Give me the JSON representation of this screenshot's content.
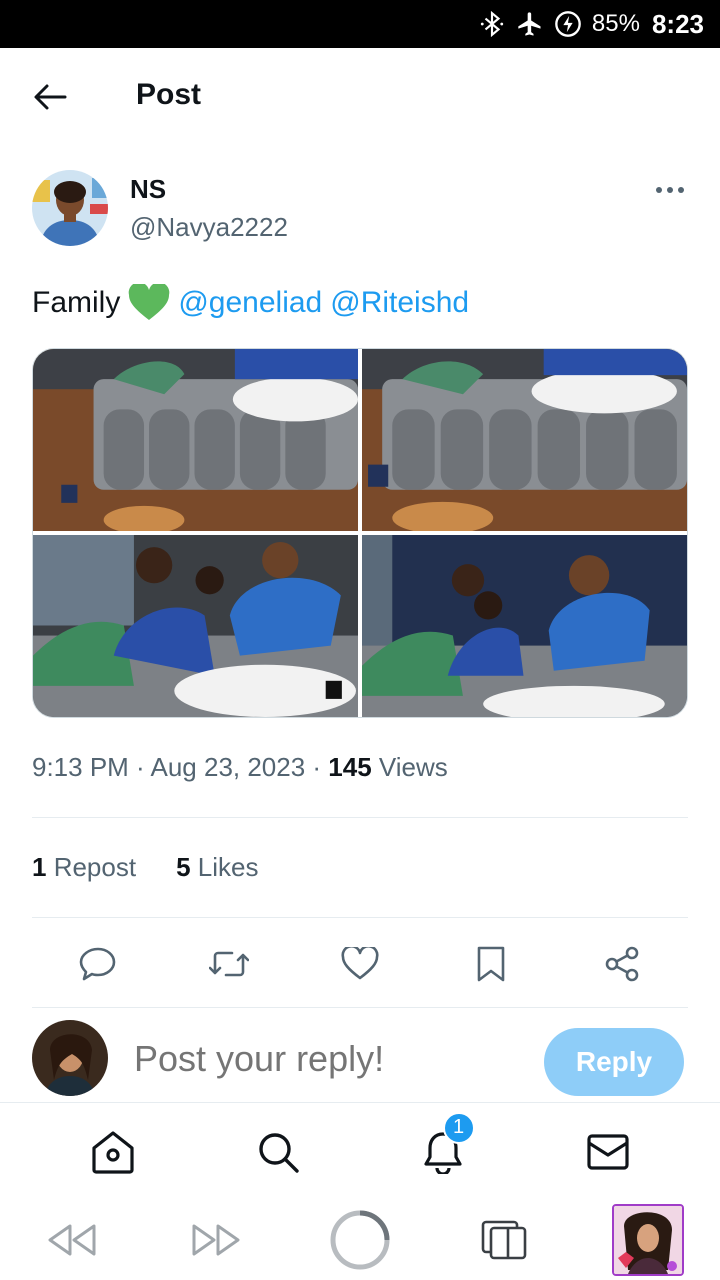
{
  "status_bar": {
    "icons": [
      "bluetooth-icon",
      "airplane-icon",
      "battery-saver-icon"
    ],
    "battery": "85%",
    "time": "8:23"
  },
  "header": {
    "title": "Post"
  },
  "post": {
    "author_name": "NS",
    "author_handle": "@Navya2222",
    "text_prefix": "Family",
    "mention_1": "@geneliad",
    "mention_2": "@Riteishd",
    "timestamp": "9:13 PM · Aug 23, 2023 · ",
    "views_count": "145",
    "views_label": " Views",
    "reposts_count": "1",
    "reposts_label": " Repost",
    "likes_count": "5",
    "likes_label": " Likes"
  },
  "actions": [
    "reply-icon",
    "repost-icon",
    "like-icon",
    "bookmark-icon",
    "share-icon"
  ],
  "reply": {
    "placeholder": "Post your reply!",
    "button_label": "Reply"
  },
  "nav": {
    "notifications_badge": "1"
  },
  "colors": {
    "accent": "#1d9bf0",
    "reply_button": "#8ecdf8",
    "heart_emoji": "#5cb85c"
  }
}
